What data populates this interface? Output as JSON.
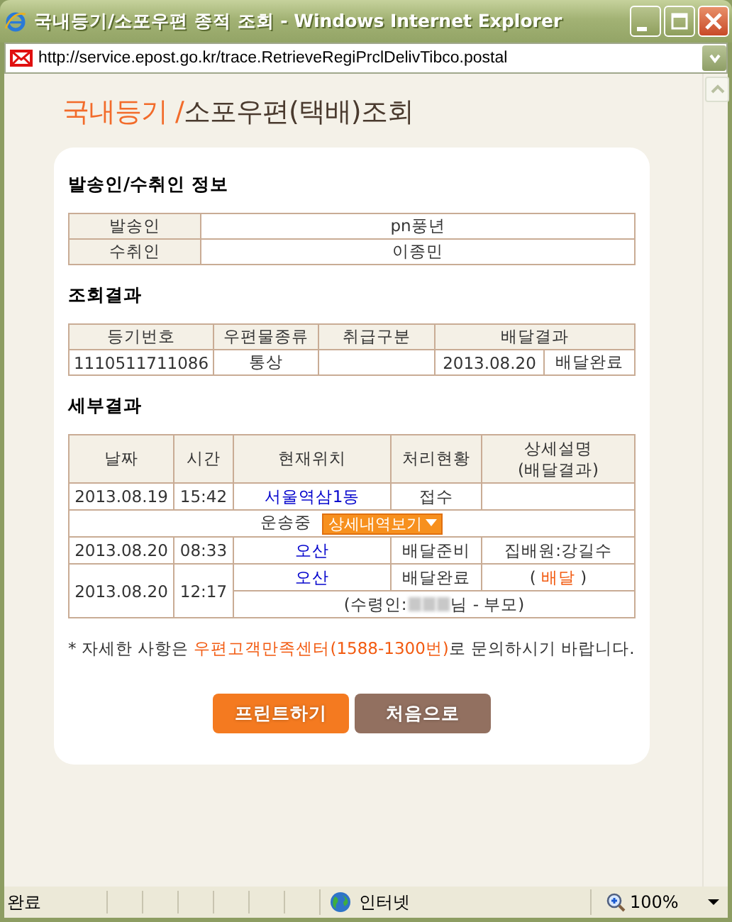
{
  "window": {
    "title": "국내등기/소포우편 종적 조회 - Windows Internet Explorer"
  },
  "address_bar": {
    "url": "http://service.epost.go.kr/trace.RetrieveRegiPrclDelivTibco.postal"
  },
  "page_title": {
    "primary": "국내등기 /",
    "secondary": "소포우편(택배)조회"
  },
  "parties": {
    "heading": "발송인/수취인 정보",
    "rows": [
      {
        "label": "발송인",
        "value": "pn풍년"
      },
      {
        "label": "수취인",
        "value": "이종민"
      }
    ]
  },
  "result": {
    "heading": "조회결과",
    "columns": [
      "등기번호",
      "우편물종류",
      "취급구분",
      "배달결과"
    ],
    "row": {
      "number": "1110511711086",
      "mail_type": "통상",
      "date": "2013.08.20",
      "status": "배달완료"
    }
  },
  "details": {
    "heading": "세부결과",
    "columns": [
      "날짜",
      "시간",
      "현재위치",
      "처리현황",
      "상세설명\n(배달결과)"
    ],
    "rows": [
      {
        "kind": "event",
        "date": "2013.08.19",
        "time": "15:42",
        "location": "서울역삼1동",
        "status": "접수"
      },
      {
        "kind": "transit",
        "label": "운송중",
        "button": "상세내역보기"
      },
      {
        "kind": "event",
        "date": "2013.08.20",
        "time": "08:33",
        "location": "오산",
        "status": "배달준비",
        "description": "집배원:강길수"
      },
      {
        "kind": "event",
        "date": "2013.08.20",
        "time": "12:17",
        "location": "오산",
        "status": "배달완료",
        "description_before": "( ",
        "description": "배달",
        "description_after": " )",
        "description_highlight": true,
        "receiver": {
          "prefix": "(수령인:",
          "suffix": "님 - 부모)"
        }
      }
    ]
  },
  "note": {
    "before": "* 자세한 사항은 ",
    "link": "우편고객만족센터(1588-1300번)",
    "after": "로 문의하시기 바랍니다."
  },
  "buttons": [
    {
      "label": "프린트하기",
      "kind": "primary"
    },
    {
      "label": "처음으로",
      "kind": "secondary"
    }
  ],
  "status_bar": {
    "status": "완료",
    "zone": "인터넷",
    "zoom": "100%"
  }
}
